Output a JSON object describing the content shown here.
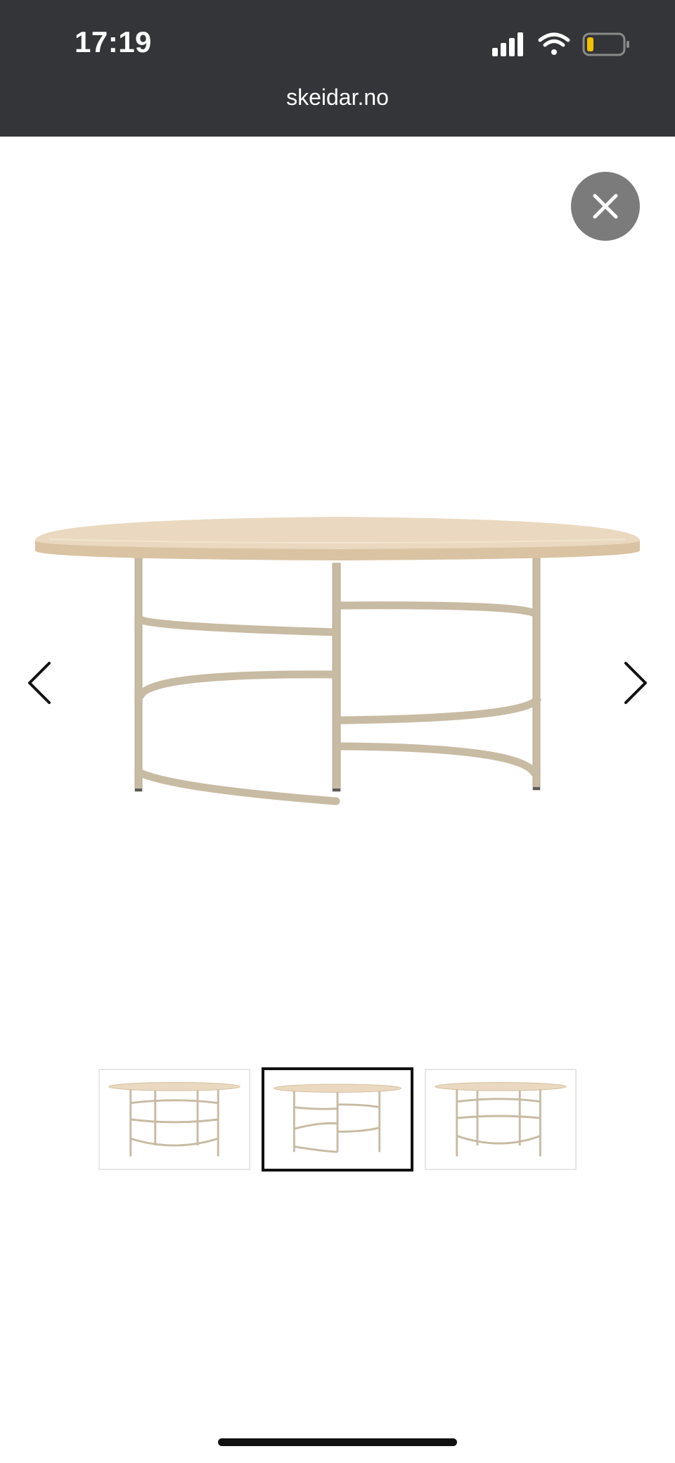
{
  "status_bar": {
    "time": "17:19",
    "icons": [
      "signal-icon",
      "wifi-icon",
      "battery-icon"
    ],
    "battery_color": "#f2c200"
  },
  "browser": {
    "url": "skeidar.no"
  },
  "viewer": {
    "close_icon": "close-icon",
    "prev_icon": "chevron-left-icon",
    "next_icon": "chevron-right-icon",
    "main_image": "round-table-image",
    "thumbnails": [
      {
        "name": "thumbnail-1",
        "active": false
      },
      {
        "name": "thumbnail-2",
        "active": true
      },
      {
        "name": "thumbnail-3",
        "active": false
      }
    ]
  },
  "colors": {
    "status_bar_bg": "#333538",
    "close_button_bg": "#7b7b7b",
    "tabletop": "#e8d7bf",
    "frame": "#c8bba3",
    "active_thumbnail_border": "#111111"
  }
}
